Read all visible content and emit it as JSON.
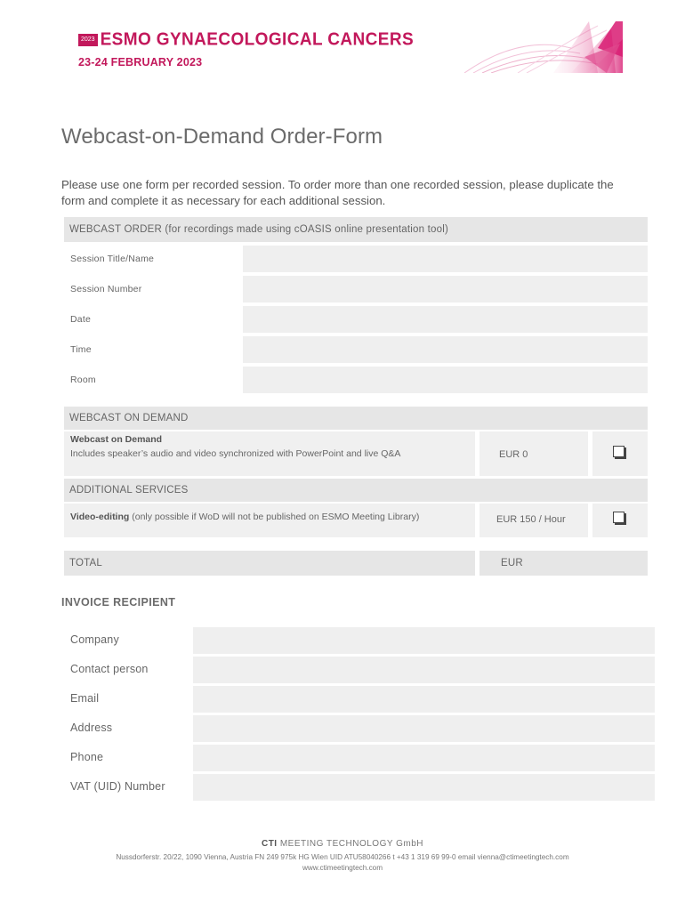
{
  "header": {
    "year_badge": "2023",
    "conference_title": "ESMO GYNAECOLOGICAL CANCERS",
    "dates": "23-24 FEBRUARY 2023"
  },
  "title": "Webcast-on-Demand Order-Form",
  "intro": "Please use one form per recorded session. To order more than one recorded session, please duplicate the form and complete it as necessary for each additional session.",
  "webcast_order": {
    "header": "WEBCAST ORDER (for recordings made using cOASIS online presentation tool)",
    "fields": [
      "Session Title/Name",
      "Session Number",
      "Date",
      "Time",
      "Room"
    ]
  },
  "webcast_on_demand": {
    "header": "WEBCAST ON DEMAND",
    "item_title": "Webcast on Demand",
    "item_desc": "Includes speaker’s audio and video synchronized with PowerPoint and live Q&A",
    "price": "EUR 0"
  },
  "additional_services": {
    "header": "ADDITIONAL SERVICES",
    "item_title": "Video-editing",
    "item_note": " (only possible if WoD will not be published on ESMO Meeting Library)",
    "price": "EUR 150 / Hour"
  },
  "total": {
    "label": "TOTAL",
    "currency": "EUR"
  },
  "invoice": {
    "header": "INVOICE RECIPIENT",
    "fields": [
      "Company",
      "Contact person",
      "Email",
      "Address",
      "Phone",
      "VAT (UID) Number"
    ]
  },
  "footer": {
    "company_bold": "CTI",
    "company_rest": " MEETING TECHNOLOGY GmbH",
    "address": "Nussdorferstr. 20/22, 1090 Vienna, Austria  FN 249 975k HG Wien  UID ATU58040266  t +43 1 319 69 99-0  email vienna@ctimeetingtech.com",
    "website": "www.ctimeetingtech.com"
  },
  "colors": {
    "brand": "#c2185b",
    "shade": "#e6e6e6"
  }
}
